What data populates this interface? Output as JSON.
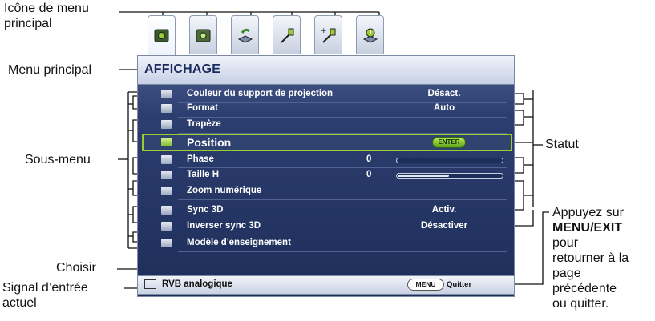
{
  "callouts": {
    "main_menu_icon": [
      "Icône de menu",
      "principal"
    ],
    "main_menu": "Menu principal",
    "sub_menu": "Sous-menu",
    "choose": "Choisir",
    "input_signal": [
      "Signal d’entrée",
      "actuel"
    ],
    "status": "Statut",
    "exit_hint": [
      "Appuyez sur",
      "MENU/EXIT",
      "pour",
      "retourner à la",
      "page",
      "précédente",
      "ou quitter."
    ]
  },
  "tabs": [
    {
      "icon": "picture-icon",
      "active": true
    },
    {
      "icon": "picture-advanced-icon",
      "active": false
    },
    {
      "icon": "settings-basic-icon",
      "active": false
    },
    {
      "icon": "system-setup-icon",
      "active": false
    },
    {
      "icon": "system-advanced-icon",
      "active": false
    },
    {
      "icon": "information-icon",
      "active": false
    }
  ],
  "menu": {
    "title": "AFFICHAGE",
    "items": [
      {
        "name": "Couleur du support de projection",
        "status": "Désact.",
        "icon": "screen-color-icon"
      },
      {
        "name": "Format",
        "status": "Auto",
        "icon": "aspect-ratio-icon"
      },
      {
        "name": "Trapèze",
        "status": "",
        "icon": "keystone-icon"
      },
      {
        "name": "Position",
        "status": "ENTER",
        "icon": "position-icon",
        "selected": true
      },
      {
        "name": "Phase",
        "value": "0",
        "slider": 0,
        "icon": "phase-icon"
      },
      {
        "name": "Taille H",
        "value": "0",
        "slider": 0.5,
        "icon": "h-size-icon"
      },
      {
        "name": "Zoom numérique",
        "status": "",
        "icon": "digital-zoom-icon"
      },
      {
        "name": "Sync 3D",
        "status": "Activ.",
        "icon": "sync-3d-icon"
      },
      {
        "name": "Inverser sync 3D",
        "status": "Désactiver",
        "icon": "invert-sync-3d-icon"
      },
      {
        "name": "Modèle d'enseignement",
        "status": "",
        "icon": "teaching-template-icon"
      }
    ]
  },
  "footer": {
    "source": "RVB analogique",
    "menu_key": "MENU",
    "quit": "Quitter"
  }
}
